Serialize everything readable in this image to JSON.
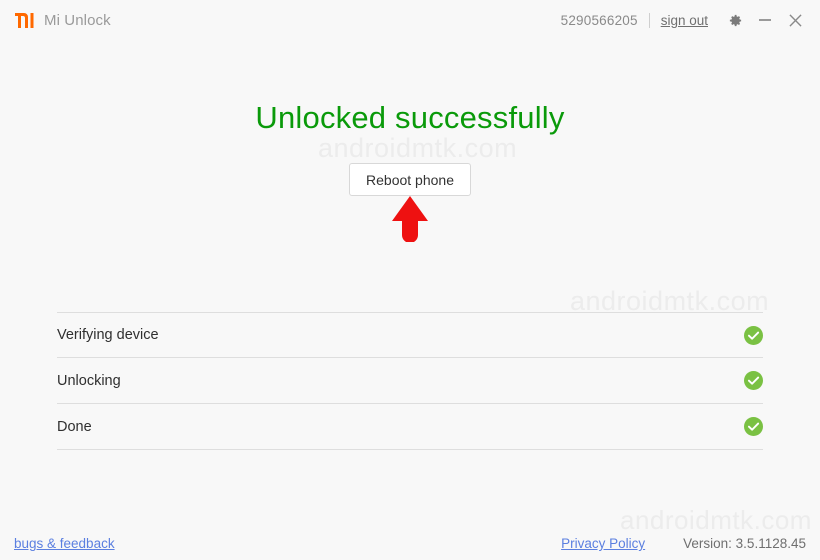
{
  "window": {
    "app_title": "Mi Unlock",
    "logo_icon": "mi-logo-icon",
    "logo_color": "#ff6900",
    "background_color": "#f8f8f8"
  },
  "titlebar": {
    "account_id": "5290566205",
    "sign_out_label": "sign out",
    "settings_icon": "gear-icon",
    "minimize_icon": "minimize-icon",
    "close_icon": "close-icon"
  },
  "main": {
    "headline": "Unlocked successfully",
    "headline_color": "#0a9a0a",
    "reboot_button_label": "Reboot phone",
    "annotation_arrow_color": "#ee1111"
  },
  "steps": [
    {
      "label": "Verifying device",
      "status_icon": "check-circle-icon",
      "status_color": "#7ac143"
    },
    {
      "label": "Unlocking",
      "status_icon": "check-circle-icon",
      "status_color": "#7ac143"
    },
    {
      "label": "Done",
      "status_icon": "check-circle-icon",
      "status_color": "#7ac143"
    }
  ],
  "footer": {
    "bugs_feedback_label": "bugs & feedback",
    "privacy_policy_label": "Privacy Policy",
    "version_label": "Version: 3.5.1128.45",
    "link_color": "#5b7fe0"
  },
  "watermarks": {
    "top": "androidmtk.com",
    "middle": "androidmtk.com",
    "bottom": "androidmtk.com"
  }
}
